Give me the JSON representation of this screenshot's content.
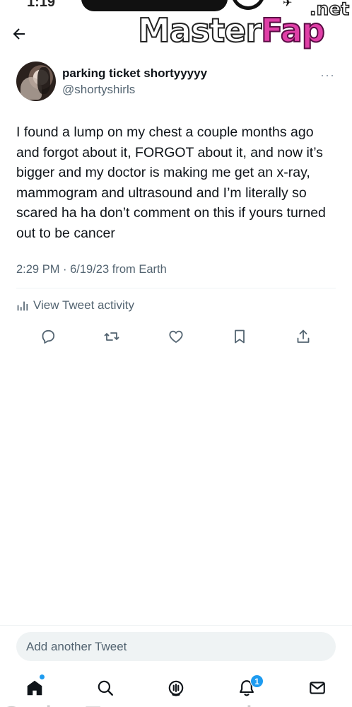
{
  "status_bar": {
    "time": "1:19",
    "extra": "✈"
  },
  "watermark": {
    "main": "Master",
    "accent": "Fap",
    "suffix": ".net"
  },
  "header": {
    "back_icon": "arrow-left-icon"
  },
  "tweet": {
    "display_name": "parking ticket shortyyyyy",
    "handle": "@shortyshirls",
    "more_icon": "···",
    "text": "I found a lump on my chest a couple months ago and forgot about it, FORGOT about it, and now it’s bigger and my doctor is making me get an x-ray, mammogram and ultrasound and I’m literally so scared ha ha don’t comment on this if yours turned out to be cancer",
    "meta": "2:29 PM · 6/19/23 from Earth",
    "activity_label": "View Tweet activity"
  },
  "actions": [
    "reply-icon",
    "retweet-icon",
    "like-icon",
    "bookmark-icon",
    "share-icon"
  ],
  "compose": {
    "placeholder": "Add another Tweet"
  },
  "nav": {
    "items": [
      "home-icon",
      "search-icon",
      "spaces-icon",
      "notifications-icon",
      "messages-icon"
    ],
    "notification_count": "1"
  },
  "bottom_text": "Only Fans my sister took and I hid",
  "colors": {
    "accent": "#1d9bf0",
    "text": "#0f1419",
    "secondary": "#536471",
    "divider": "#eff3f4"
  }
}
